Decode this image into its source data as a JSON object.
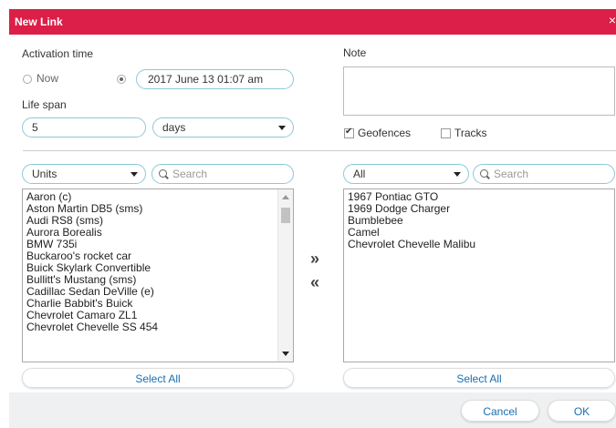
{
  "dialog": {
    "title": "New Link",
    "close_glyph": "×"
  },
  "activation": {
    "label": "Activation time",
    "now_label": "Now",
    "datetime_value": "2017 June 13 01:07 am"
  },
  "lifespan": {
    "label": "Life span",
    "value": "5",
    "unit": "days"
  },
  "note": {
    "label": "Note",
    "value": ""
  },
  "options": {
    "geofences_label": "Geofences",
    "geofences_checked": true,
    "tracks_label": "Tracks",
    "tracks_checked": false
  },
  "left_panel": {
    "filter": "Units",
    "search_placeholder": "Search",
    "items": [
      "Aaron (c)",
      "Aston Martin DB5 (sms)",
      "Audi RS8 (sms)",
      "Aurora Borealis",
      "BMW 735i",
      "Buckaroo's rocket car",
      "Buick Skylark Convertible",
      "Bullitt's Mustang (sms)",
      "Cadillac Sedan DeVille (e)",
      "Charlie Babbit's Buick",
      "Chevrolet Camaro ZL1",
      "Chevrolet Chevelle SS 454"
    ],
    "select_all": "Select All"
  },
  "transfer": {
    "add_glyph": "»",
    "remove_glyph": "«"
  },
  "right_panel": {
    "filter": "All",
    "search_placeholder": "Search",
    "items": [
      "1967 Pontiac GTO",
      "1969 Dodge Charger",
      "Bumblebee",
      "Camel",
      "Chevrolet Chevelle Malibu"
    ],
    "select_all": "Select All"
  },
  "footer": {
    "cancel": "Cancel",
    "ok": "OK"
  },
  "colors": {
    "titlebar": "#dc1f48",
    "accent_blue": "#1a6fb0",
    "pill_border": "#8cc8d8"
  }
}
